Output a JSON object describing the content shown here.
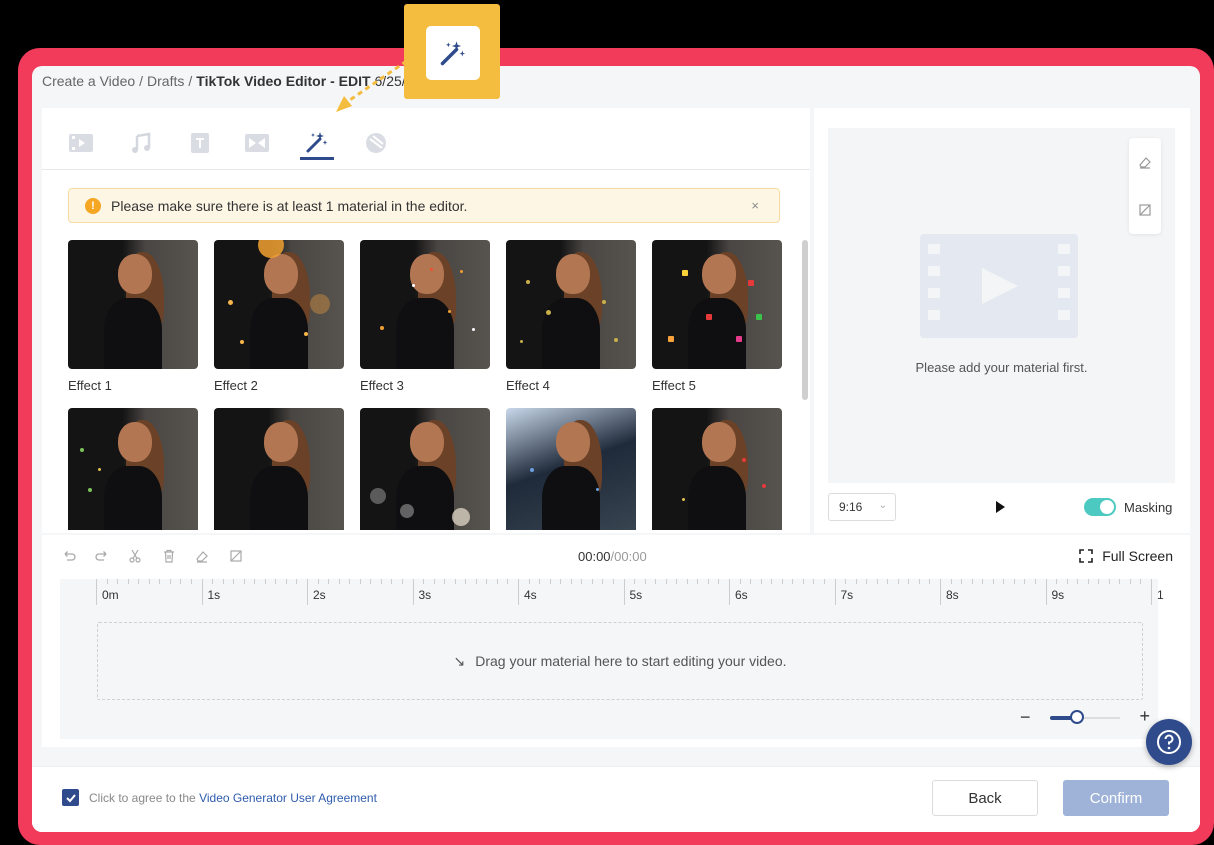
{
  "breadcrumb": {
    "root": "Create a Video",
    "drafts": "Drafts",
    "current": "TikTok Video Editor - EDIT",
    "date": "6/25/2021",
    "edit_icon": "pencil-icon"
  },
  "toolbar_tabs": [
    {
      "icon": "video-icon"
    },
    {
      "icon": "music-icon"
    },
    {
      "icon": "text-icon"
    },
    {
      "icon": "transition-icon"
    },
    {
      "icon": "magic-wand-icon",
      "active": true
    },
    {
      "icon": "sticker-icon"
    }
  ],
  "alert": {
    "icon": "!",
    "text": "Please make sure there is at least 1 material in the editor.",
    "close": "×"
  },
  "effects": [
    {
      "label": "Effect 1"
    },
    {
      "label": "Effect 2"
    },
    {
      "label": "Effect 3"
    },
    {
      "label": "Effect 4"
    },
    {
      "label": "Effect 5"
    },
    {
      "label": ""
    },
    {
      "label": ""
    },
    {
      "label": ""
    },
    {
      "label": ""
    },
    {
      "label": ""
    }
  ],
  "preview": {
    "message": "Please add your material first.",
    "ratio": "9:16",
    "masking_label": "Masking",
    "masking_on": true
  },
  "timeline": {
    "current_time": "00:00",
    "total_time": "/00:00",
    "full_screen": "Full Screen",
    "ticks": [
      "0m",
      "1s",
      "2s",
      "3s",
      "4s",
      "5s",
      "6s",
      "7s",
      "8s",
      "9s",
      "1"
    ],
    "drop_message": "Drag your material here to start editing your video.",
    "zoom_minus": "−",
    "zoom_plus": "+"
  },
  "footer": {
    "agree_text": "Click to agree to the ",
    "agree_link": "Video Generator User Agreement",
    "back": "Back",
    "confirm": "Confirm"
  },
  "colors": {
    "frame": "#f23a5a",
    "primary": "#2f4b8c",
    "callout": "#f5bd3f",
    "toggle": "#4cc9c0"
  }
}
